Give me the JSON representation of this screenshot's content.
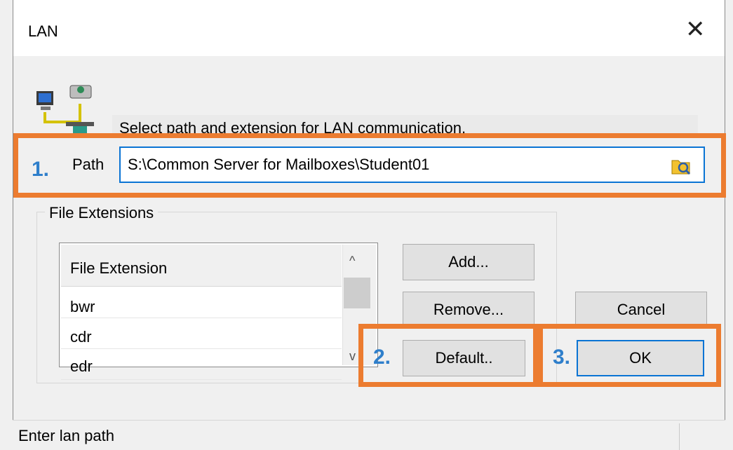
{
  "window": {
    "title": "LAN"
  },
  "instruction": "Select path and extension for LAN communication.",
  "path": {
    "label": "Path",
    "value": "S:\\Common Server for Mailboxes\\Student01"
  },
  "file_extensions": {
    "group_label": "File Extensions",
    "column_header": "File Extension",
    "rows": [
      "bwr",
      "cdr",
      "edr"
    ]
  },
  "buttons": {
    "add": "Add...",
    "remove": "Remove...",
    "default": "Default..",
    "cancel": "Cancel",
    "ok": "OK"
  },
  "status": {
    "text": "Enter lan path"
  },
  "annotations": {
    "one": "1.",
    "two": "2.",
    "three": "3."
  },
  "colors": {
    "highlight": "#ec7c30",
    "number": "#2f7fcb",
    "focus": "#0a74d4"
  }
}
